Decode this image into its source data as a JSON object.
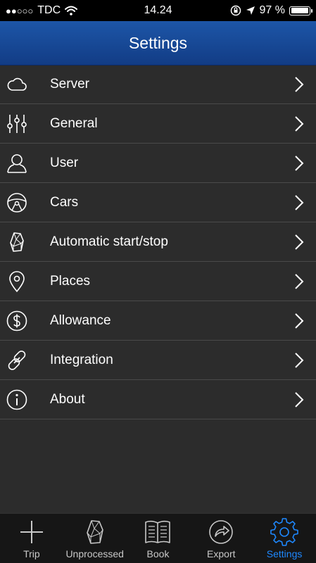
{
  "status": {
    "signal": "●●○○○",
    "carrier": "TDC",
    "time": "14.24",
    "battery": "97 %",
    "battery_level": 0.97
  },
  "header": {
    "title": "Settings"
  },
  "settings": {
    "items": [
      {
        "label": "Server",
        "icon": "cloud-icon"
      },
      {
        "label": "General",
        "icon": "sliders-icon"
      },
      {
        "label": "User",
        "icon": "user-icon"
      },
      {
        "label": "Cars",
        "icon": "steering-wheel-icon"
      },
      {
        "label": "Automatic start/stop",
        "icon": "beacon-icon"
      },
      {
        "label": "Places",
        "icon": "map-pin-icon"
      },
      {
        "label": "Allowance",
        "icon": "dollar-icon"
      },
      {
        "label": "Integration",
        "icon": "link-icon"
      },
      {
        "label": "About",
        "icon": "info-icon"
      }
    ]
  },
  "tabs": [
    {
      "label": "Trip",
      "icon": "plus-icon",
      "active": false
    },
    {
      "label": "Unprocessed",
      "icon": "beacon-icon",
      "active": false
    },
    {
      "label": "Book",
      "icon": "book-icon",
      "active": false
    },
    {
      "label": "Export",
      "icon": "export-icon",
      "active": false
    },
    {
      "label": "Settings",
      "icon": "gear-icon",
      "active": true
    }
  ],
  "colors": {
    "header_gradient_top": "#1d56a8",
    "header_gradient_bottom": "#123c85",
    "background": "#2c2c2c",
    "tab_active": "#1e88ff",
    "tab_inactive": "#c8c8c8"
  }
}
